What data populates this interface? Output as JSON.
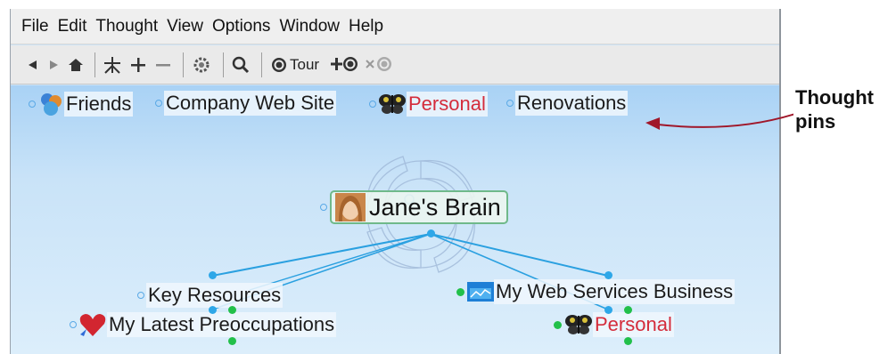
{
  "menu": [
    "File",
    "Edit",
    "Thought",
    "View",
    "Options",
    "Window",
    "Help"
  ],
  "toolbar": {
    "tour_label": "Tour"
  },
  "pins": [
    {
      "label": "Friends",
      "icon": "people-icon"
    },
    {
      "label": "Company Web Site",
      "icon": ""
    },
    {
      "label": "Personal",
      "icon": "butterfly-icon",
      "color": "#d42c3b"
    },
    {
      "label": "Renovations",
      "icon": ""
    }
  ],
  "central": {
    "label": "Jane's Brain",
    "icon": "face-photo-icon"
  },
  "children": [
    {
      "label": "Key Resources"
    },
    {
      "label": "My Web Services Business",
      "icon": "web-icon"
    },
    {
      "label": "My Latest Preoccupations",
      "icon": "heart-icon"
    },
    {
      "label": "Personal",
      "icon": "butterfly-icon",
      "color": "#d42c3b"
    }
  ],
  "annotation": {
    "line1": "Thought",
    "line2": "pins"
  },
  "colors": {
    "link_blue": "#2ea7e8",
    "connector_green": "#22c04a",
    "arrow": "#a0172a"
  }
}
